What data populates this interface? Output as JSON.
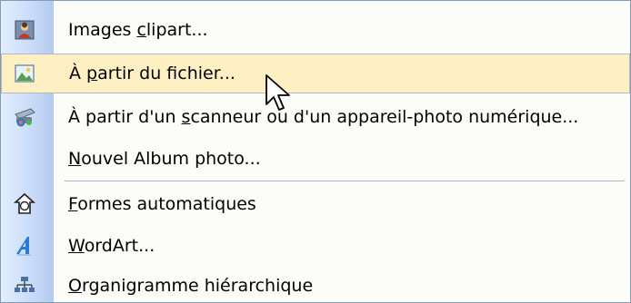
{
  "menu": {
    "items": [
      {
        "pre": "Images ",
        "acc": "c",
        "post": "lipart...",
        "icon": "clipart-icon"
      },
      {
        "pre": "À ",
        "acc": "p",
        "post": "artir du fichier...",
        "icon": "picture-file-icon"
      },
      {
        "pre": "À partir d'un ",
        "acc": "s",
        "post": "canneur ou d'un appareil-photo numérique...",
        "icon": "scanner-camera-icon"
      },
      {
        "pre": "",
        "acc": "N",
        "post": "ouvel Album photo...",
        "icon": ""
      },
      {
        "pre": "",
        "acc": "F",
        "post": "ormes automatiques",
        "icon": "autoshapes-icon"
      },
      {
        "pre": "",
        "acc": "W",
        "post": "ordArt...",
        "icon": "wordart-icon"
      },
      {
        "pre": "",
        "acc": "O",
        "post": "rganigramme hiérarchique",
        "icon": "org-chart-icon"
      }
    ]
  },
  "colors": {
    "hover_bg": "#fff0c4",
    "icon_strip": "#c8dbf7",
    "border": "#7f9db9"
  }
}
